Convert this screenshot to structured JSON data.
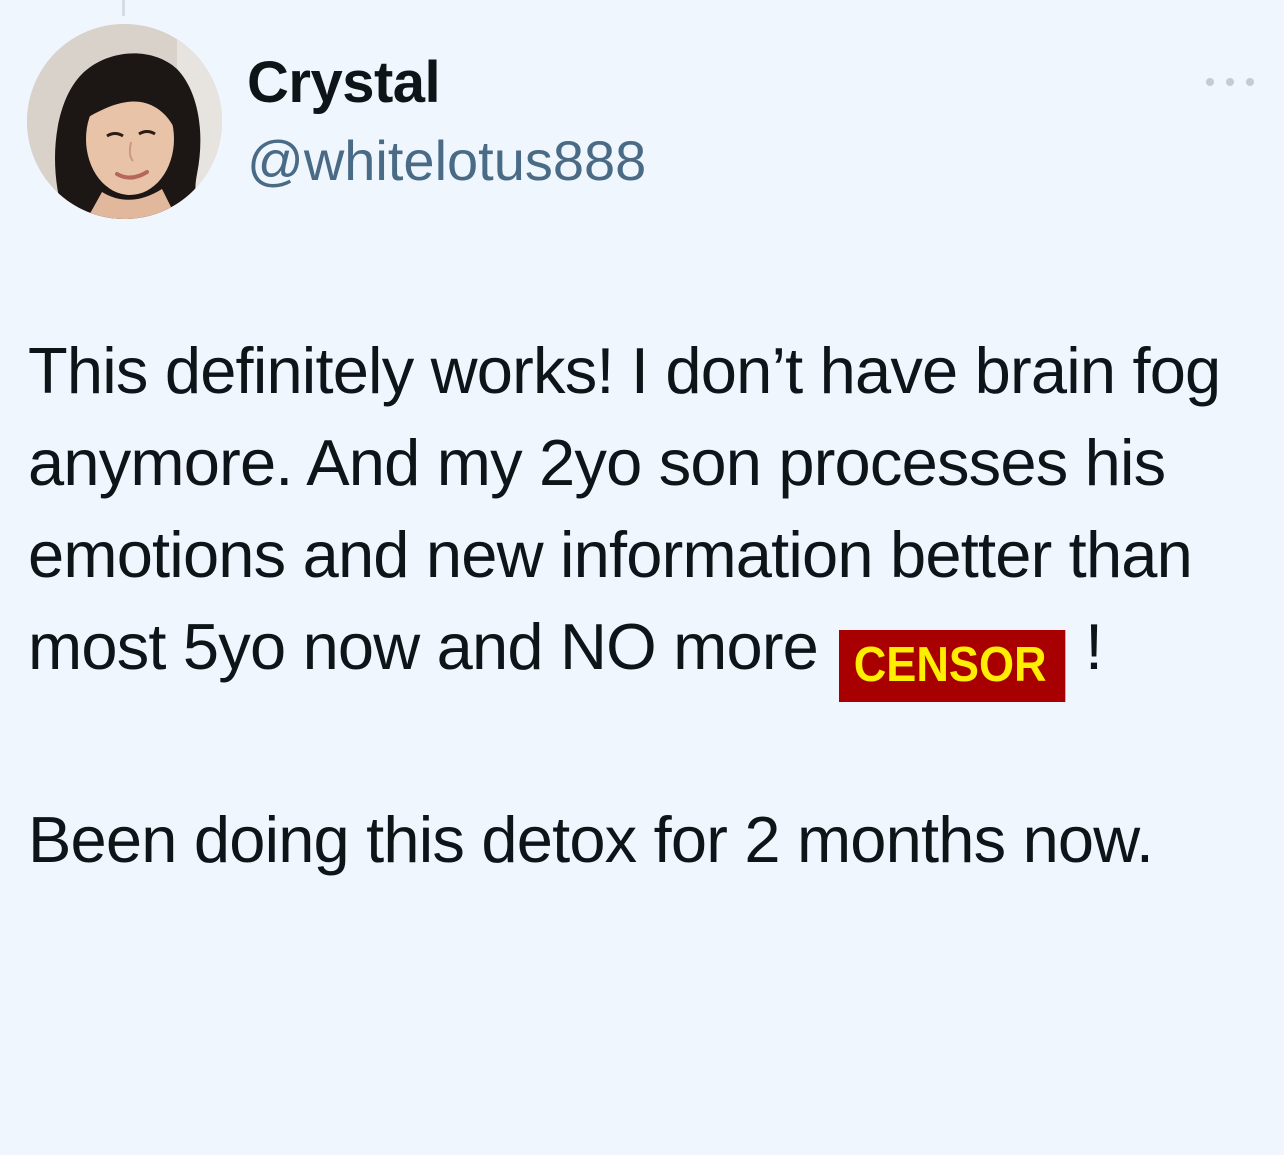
{
  "author": {
    "display_name": "Crystal",
    "handle": "@whitelotus888",
    "avatar_icon": "profile-photo"
  },
  "more_menu": {
    "icon": "more-horizontal-icon"
  },
  "tweet": {
    "paragraph_1_before": "This definitely works! I don’t have brain fog anymore. And my 2yo son processes his emotions and new information better than most 5yo now and NO more ",
    "censor_label": "CENSOR",
    "paragraph_1_after": "!",
    "paragraph_2": "Been doing this detox for 2 months now."
  },
  "colors": {
    "background": "#f0f6fd",
    "text": "#0f1419",
    "handle": "#4a6b86",
    "censor_bg": "#a80000",
    "censor_text": "#ffee00"
  }
}
